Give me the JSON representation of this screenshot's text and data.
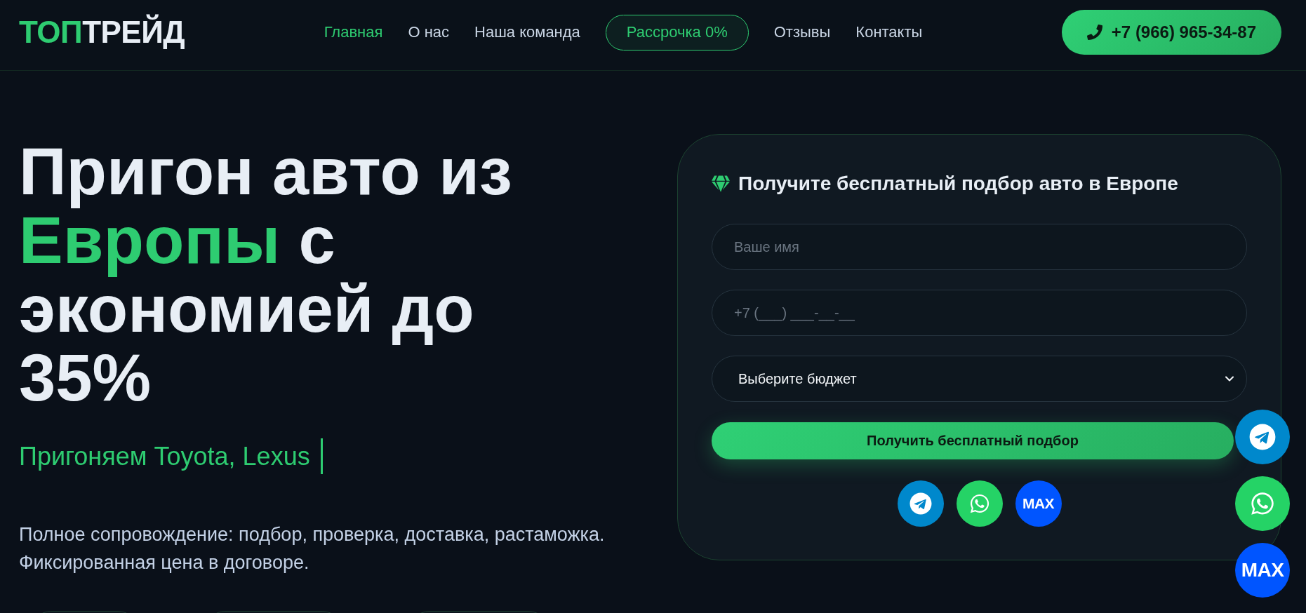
{
  "header": {
    "logo": [
      {
        "text": "ТОП",
        "accent": true
      },
      {
        "text": "ТРЕЙД",
        "accent": false
      }
    ],
    "nav": [
      {
        "label": "Главная",
        "selected": true,
        "kind": "link"
      },
      {
        "label": "О нас",
        "selected": false,
        "kind": "link"
      },
      {
        "label": "Наша команда",
        "selected": false,
        "kind": "link"
      },
      {
        "label": "Рассрочка 0%",
        "selected": false,
        "kind": "pill"
      },
      {
        "label": "Отзывы",
        "selected": false,
        "kind": "link"
      },
      {
        "label": "Контакты",
        "selected": false,
        "kind": "link"
      }
    ],
    "phone_button": {
      "label": "+7 (966) 965-34-87"
    }
  },
  "hero": {
    "title": [
      {
        "text": "Пригон авто из ",
        "accent": false
      },
      {
        "text": "Европы",
        "accent": true
      },
      {
        "text": " с экономией до 35%",
        "accent": false
      }
    ],
    "subtitle": "Пригоняем Toyota, Lexus",
    "description": "Полное сопровождение: подбор, проверка, доставка, растаможка. Фиксированная цена в договоре.",
    "badges": [
      {
        "kind": "outline"
      },
      {
        "kind": "outline"
      },
      {
        "kind": "outline"
      }
    ]
  },
  "form": {
    "title": "Получите бесплатный подбор авто в Европе",
    "fields": [
      {
        "kind": "text",
        "placeholder": "Ваше имя"
      },
      {
        "kind": "phone",
        "placeholder": "+7 (___) ___-__-__"
      },
      {
        "kind": "select",
        "value": "Выберите бюджет"
      }
    ],
    "submit": "Получить бесплатный подбор",
    "messengers": [
      {
        "kind": "telegram",
        "color": "#0088cc"
      },
      {
        "kind": "whatsapp",
        "color": "#25d366"
      },
      {
        "kind": "max",
        "label": "MAX",
        "color": "#0055ff"
      }
    ]
  },
  "floating_messengers": [
    {
      "kind": "telegram",
      "color": "#0088cc"
    },
    {
      "kind": "whatsapp",
      "color": "#25d366"
    },
    {
      "kind": "max",
      "label": "MAX",
      "color": "#0055ff"
    }
  ]
}
